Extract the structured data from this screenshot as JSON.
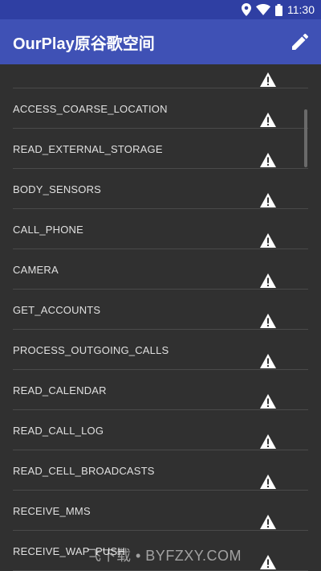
{
  "status": {
    "time": "11:30"
  },
  "appbar": {
    "title": "OurPlay原谷歌空间"
  },
  "permissions": [
    {
      "name": ""
    },
    {
      "name": "ACCESS_COARSE_LOCATION"
    },
    {
      "name": "READ_EXTERNAL_STORAGE"
    },
    {
      "name": "BODY_SENSORS"
    },
    {
      "name": "CALL_PHONE"
    },
    {
      "name": "CAMERA"
    },
    {
      "name": "GET_ACCOUNTS"
    },
    {
      "name": "PROCESS_OUTGOING_CALLS"
    },
    {
      "name": "READ_CALENDAR"
    },
    {
      "name": "READ_CALL_LOG"
    },
    {
      "name": "READ_CELL_BROADCASTS"
    },
    {
      "name": "RECEIVE_MMS"
    },
    {
      "name": "RECEIVE_WAP_PUSH"
    }
  ],
  "watermark": "飞下载 • BYFZXY.COM",
  "colors": {
    "primary": "#3f51b5",
    "primary_dark": "#2f3fa3",
    "background": "#303030"
  }
}
